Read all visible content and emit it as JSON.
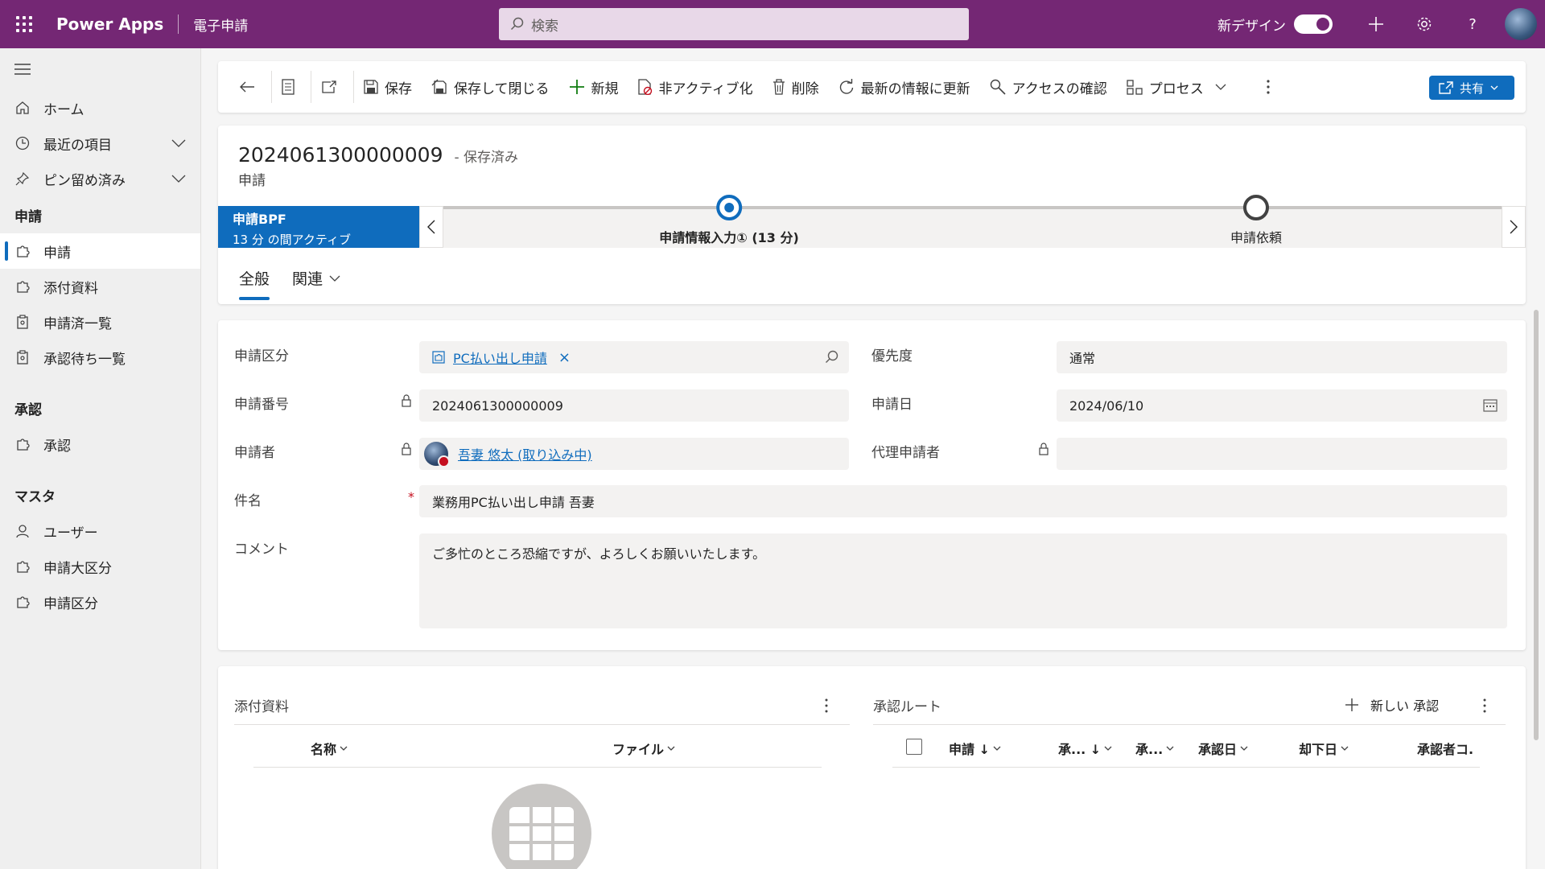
{
  "topbar": {
    "app_name": "Power Apps",
    "environment": "電子申請",
    "search_placeholder": "検索",
    "new_design_label": "新デザイン"
  },
  "sidebar": {
    "items_top": [
      {
        "label": "ホーム",
        "icon": "home-icon"
      },
      {
        "label": "最近の項目",
        "icon": "clock-icon"
      },
      {
        "label": "ピン留め済み",
        "icon": "pin-icon"
      }
    ],
    "sections": [
      {
        "title": "申請",
        "items": [
          {
            "label": "申請",
            "icon": "puzzle-icon",
            "active": true
          },
          {
            "label": "添付資料",
            "icon": "puzzle-icon"
          },
          {
            "label": "申請済一覧",
            "icon": "clipboard-icon"
          },
          {
            "label": "承認待ち一覧",
            "icon": "clipboard-icon"
          }
        ]
      },
      {
        "title": "承認",
        "items": [
          {
            "label": "承認",
            "icon": "puzzle-icon"
          }
        ]
      },
      {
        "title": "マスタ",
        "items": [
          {
            "label": "ユーザー",
            "icon": "person-icon"
          },
          {
            "label": "申請大区分",
            "icon": "puzzle-icon"
          },
          {
            "label": "申請区分",
            "icon": "puzzle-icon"
          }
        ]
      }
    ]
  },
  "commandbar": {
    "save": "保存",
    "save_close": "保存して閉じる",
    "new": "新規",
    "deactivate": "非アクティブ化",
    "delete": "削除",
    "refresh": "最新の情報に更新",
    "check_access": "アクセスの確認",
    "process": "プロセス",
    "share": "共有"
  },
  "record": {
    "title": "2024061300000009",
    "status": "- 保存済み",
    "entity": "申請"
  },
  "bpf": {
    "name": "申請BPF",
    "active_time": "13 分 の間アクティブ",
    "stages": [
      {
        "label": "申請情報入力①  (13 分)",
        "state": "active"
      },
      {
        "label": "申請依頼",
        "state": "inactive"
      }
    ]
  },
  "tabs": {
    "general": "全般",
    "related": "関連"
  },
  "form": {
    "category_label": "申請区分",
    "category_value": "PC払い出し申請",
    "priority_label": "優先度",
    "priority_value": "通常",
    "number_label": "申請番号",
    "number_value": "2024061300000009",
    "date_label": "申請日",
    "date_value": "2024/06/10",
    "applicant_label": "申請者",
    "applicant_value": "吾妻 悠太 (取り込み中)",
    "proxy_label": "代理申請者",
    "proxy_value": "",
    "subject_label": "件名",
    "subject_required": "*",
    "subject_value": "業務用PC払い出し申請 吾妻",
    "comment_label": "コメント",
    "comment_value": "ご多忙のところ恐縮ですが、よろしくお願いいたします。"
  },
  "attachments": {
    "title": "添付資料",
    "col_name": "名称",
    "col_file": "ファイル"
  },
  "approval_route": {
    "title": "承認ルート",
    "new_label": "新しい 承認",
    "col_request": "申請 ↓",
    "col_approval1": "承... ↓",
    "col_approval2": "承...",
    "col_approve_date": "承認日",
    "col_reject_date": "却下日",
    "col_approver": "承認者コ."
  },
  "colors": {
    "brand": "#742774",
    "accent": "#0f6cbd"
  }
}
